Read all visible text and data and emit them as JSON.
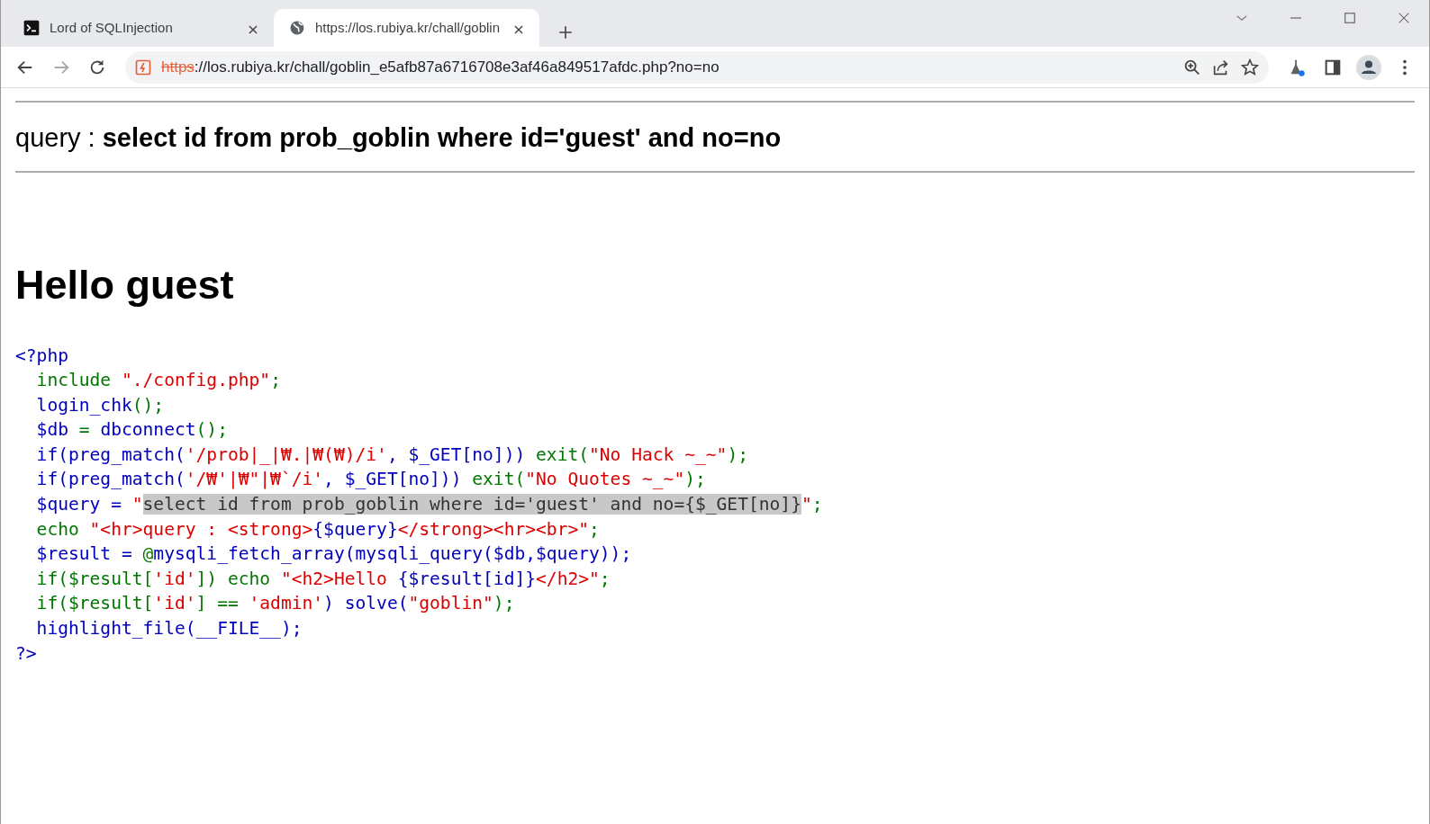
{
  "browser": {
    "tabs": [
      {
        "title": "Lord of SQLInjection",
        "kind": "app",
        "selected": false
      },
      {
        "title": "https://los.rubiya.kr/chall/goblin",
        "kind": "web",
        "selected": true
      }
    ],
    "address": {
      "scheme": "https",
      "rest": "://los.rubiya.kr/chall/goblin_e5afb87a6716708e3af46a849517afdc.php?no=no",
      "insecure": true
    }
  },
  "page": {
    "query_line": "query : **select id from prob_goblin where id='guest' and no=no**",
    "heading": "Hello guest",
    "code_lines": [
      [
        {
          "kind": "default",
          "text": "<?php"
        }
      ],
      [
        {
          "kind": "keyword",
          "text": "  include "
        },
        {
          "kind": "string",
          "text": "\"./config.php\""
        },
        {
          "kind": "keyword",
          "text": ";"
        }
      ],
      [
        {
          "kind": "default",
          "text": "  login_chk"
        },
        {
          "kind": "keyword",
          "text": "();"
        }
      ],
      [
        {
          "kind": "default",
          "text": "  $db "
        },
        {
          "kind": "keyword",
          "text": "= "
        },
        {
          "kind": "default",
          "text": "dbconnect"
        },
        {
          "kind": "keyword",
          "text": "();"
        }
      ],
      [
        {
          "kind": "default",
          "text": "  if(preg_match("
        },
        {
          "kind": "string",
          "text": "'/prob|_|₩.|₩(₩)/i'"
        },
        {
          "kind": "default",
          "text": ", $_GET[no])) "
        },
        {
          "kind": "keyword",
          "text": "exit("
        },
        {
          "kind": "string",
          "text": "\"No Hack ~_~\""
        },
        {
          "kind": "keyword",
          "text": ");"
        }
      ],
      [
        {
          "kind": "default",
          "text": "  if(preg_match("
        },
        {
          "kind": "string",
          "text": "'/₩'|₩\"|₩`/i'"
        },
        {
          "kind": "default",
          "text": ", $_GET[no])) "
        },
        {
          "kind": "keyword",
          "text": "exit("
        },
        {
          "kind": "string",
          "text": "\"No Quotes ~_~\""
        },
        {
          "kind": "keyword",
          "text": ");"
        }
      ],
      [
        {
          "kind": "default",
          "text": "  $query = "
        },
        {
          "kind": "string",
          "text": "\""
        },
        {
          "kind": "highlight",
          "text": "select id from prob_goblin where id='guest' and no={$_GET[no]}"
        },
        {
          "kind": "string",
          "text": "\""
        },
        {
          "kind": "keyword",
          "text": ";"
        }
      ],
      [
        {
          "kind": "keyword",
          "text": "  echo "
        },
        {
          "kind": "string",
          "text": "\"<hr>query : <strong>"
        },
        {
          "kind": "default",
          "text": "{$query}"
        },
        {
          "kind": "string",
          "text": "</strong><hr><br>\""
        },
        {
          "kind": "keyword",
          "text": ";"
        }
      ],
      [
        {
          "kind": "default",
          "text": "  $result = "
        },
        {
          "kind": "keyword",
          "text": "@"
        },
        {
          "kind": "default",
          "text": "mysqli_fetch_array(mysqli_query($db,$query));"
        }
      ],
      [
        {
          "kind": "keyword",
          "text": "  if($result["
        },
        {
          "kind": "string",
          "text": "'id'"
        },
        {
          "kind": "keyword",
          "text": "]) echo "
        },
        {
          "kind": "string",
          "text": "\"<h2>Hello "
        },
        {
          "kind": "default",
          "text": "{$result[id]}"
        },
        {
          "kind": "string",
          "text": "</h2>\""
        },
        {
          "kind": "keyword",
          "text": ";"
        }
      ],
      [
        {
          "kind": "keyword",
          "text": "  if($result["
        },
        {
          "kind": "string",
          "text": "'id'"
        },
        {
          "kind": "keyword",
          "text": "] == "
        },
        {
          "kind": "string",
          "text": "'admin'"
        },
        {
          "kind": "default",
          "text": ") solve("
        },
        {
          "kind": "string",
          "text": "\"goblin\""
        },
        {
          "kind": "keyword",
          "text": ");"
        }
      ],
      [
        {
          "kind": "default",
          "text": "  highlight_file(__FILE__);"
        }
      ],
      [
        {
          "kind": "default",
          "text": "?>"
        }
      ]
    ]
  }
}
